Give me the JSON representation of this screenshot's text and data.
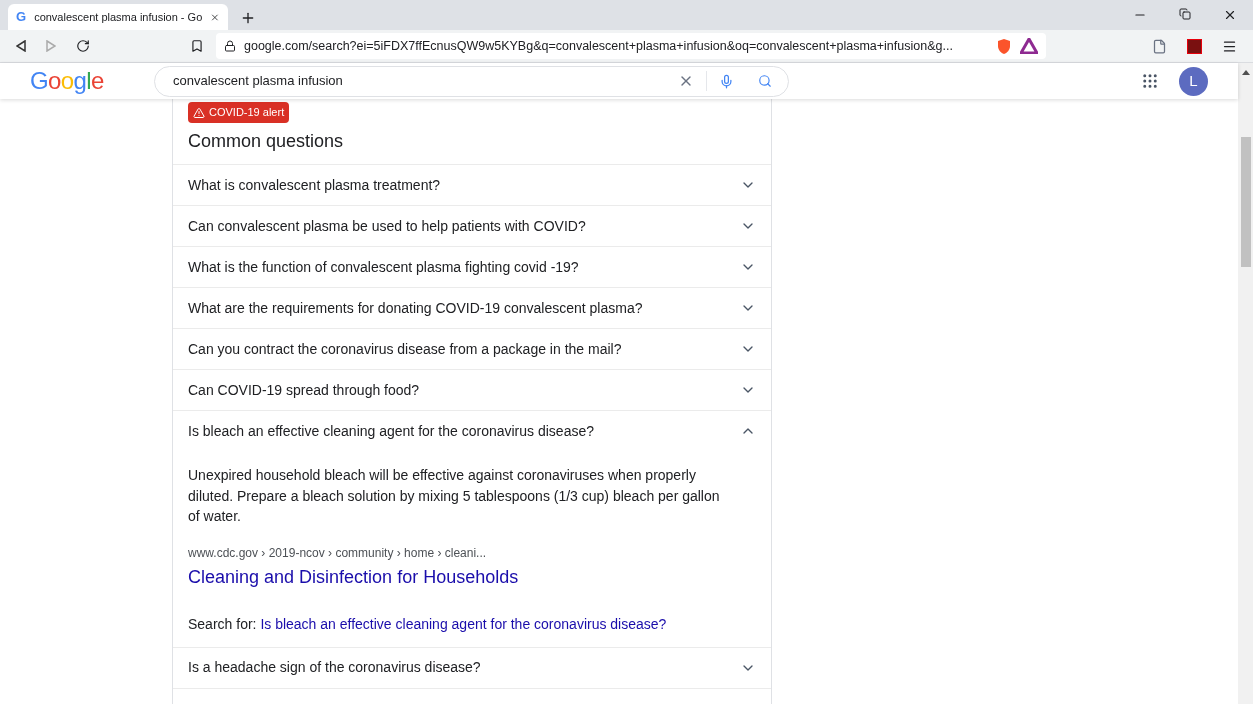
{
  "browser": {
    "favicon": "G",
    "tab_title": "convalescent plasma infusion - Go",
    "url": "google.com/search?ei=5iFDX7ffEcnusQW9w5KYBg&q=convalescent+plasma+infusion&oq=convalescent+plasma+infusion&g..."
  },
  "search": {
    "logo": "Google",
    "value": "convalescent plasma infusion",
    "avatar": "L"
  },
  "panel": {
    "alert": "COVID-19 alert",
    "title": "Common questions",
    "questions": [
      {
        "text": "What is convalescent plasma treatment?",
        "expanded": false
      },
      {
        "text": "Can convalescent plasma be used to help patients with COVID?",
        "expanded": false
      },
      {
        "text": "What is the function of convalescent plasma fighting covid -19?",
        "expanded": false
      },
      {
        "text": "What are the requirements for donating COVID-19 convalescent plasma?",
        "expanded": false
      },
      {
        "text": "Can you contract the coronavirus disease from a package in the mail?",
        "expanded": false
      },
      {
        "text": "Can COVID-19 spread through food?",
        "expanded": false
      },
      {
        "text": "Is bleach an effective cleaning agent for the coronavirus disease?",
        "expanded": true,
        "answer": {
          "snippet": "Unexpired household bleach will be effective against coronaviruses when properly diluted. Prepare a bleach solution by mixing 5 tablespoons (1/3 cup) bleach per gallon of water.",
          "breadcrumb": "www.cdc.gov › 2019-ncov › community › home › cleani...",
          "link": "Cleaning and Disinfection for Households",
          "search_for_label": "Search for:",
          "search_for_link": "Is bleach an effective cleaning agent for the coronavirus disease?"
        }
      },
      {
        "text": "Is a headache sign of the coronavirus disease?",
        "expanded": false
      }
    ]
  }
}
